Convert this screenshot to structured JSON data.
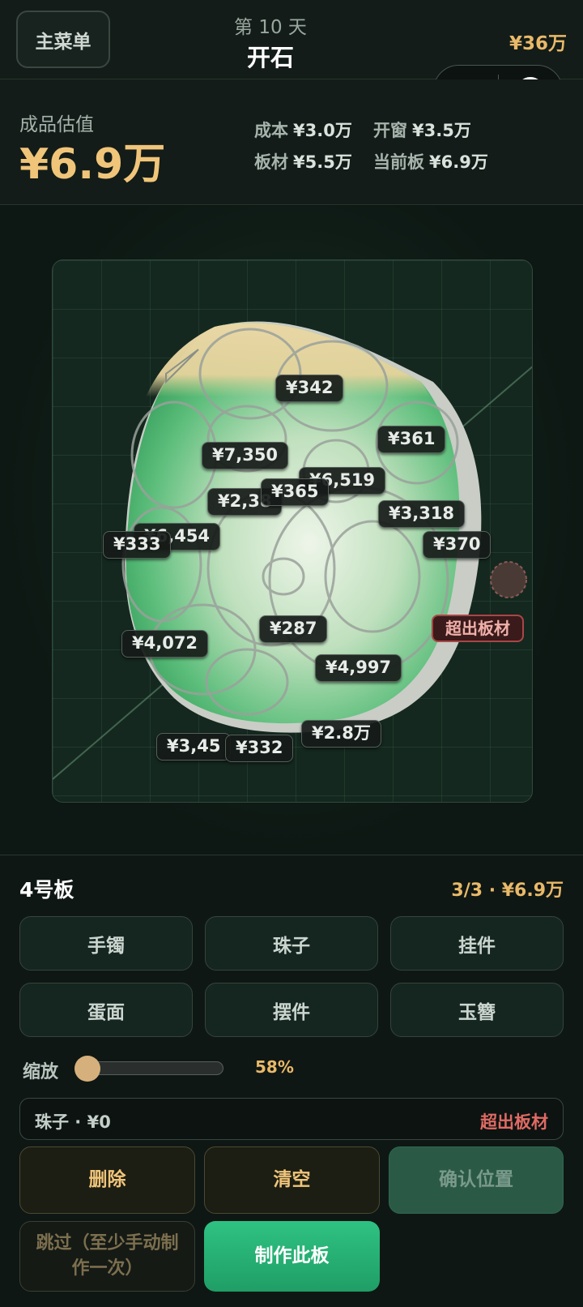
{
  "header": {
    "menu_label": "主菜单",
    "day_label": "第 10 天",
    "title": "开石",
    "money": "¥36万"
  },
  "valuation": {
    "label": "成品估值",
    "value": "¥6.9万",
    "stats": [
      {
        "key": "成本",
        "value": "¥3.0万"
      },
      {
        "key": "开窗",
        "value": "¥3.5万"
      },
      {
        "key": "板材",
        "value": "¥5.5万"
      },
      {
        "key": "当前板",
        "value": "¥6.9万"
      }
    ]
  },
  "board": {
    "price_tags": [
      "¥342",
      "¥361",
      "¥7,350",
      "¥6,519",
      "¥365",
      "¥2,38",
      "¥3,318",
      "¥6,454",
      "¥333",
      "¥370",
      "¥287",
      "¥4,072",
      "¥4,997",
      "¥2.8万",
      "¥3,45",
      "¥332"
    ],
    "warning": "超出板材"
  },
  "panel": {
    "board_name": "4号板",
    "progress": "3/3 · ¥6.9万",
    "categories": [
      "手镯",
      "珠子",
      "挂件",
      "蛋面",
      "摆件",
      "玉簪"
    ],
    "zoom_label": "缩放",
    "zoom_value": "58%",
    "zoom_fraction": 0.0,
    "status_left": "珠子 · ¥0",
    "status_right": "超出板材",
    "delete_label": "删除",
    "clear_label": "清空",
    "confirm_label": "确认位置",
    "skip_label": "跳过（至少手动制作一次）",
    "make_label": "制作此板"
  },
  "colors": {
    "accent_gold": "#f0c57a",
    "accent_green": "#2fc282",
    "warning_red": "#e06a64"
  }
}
